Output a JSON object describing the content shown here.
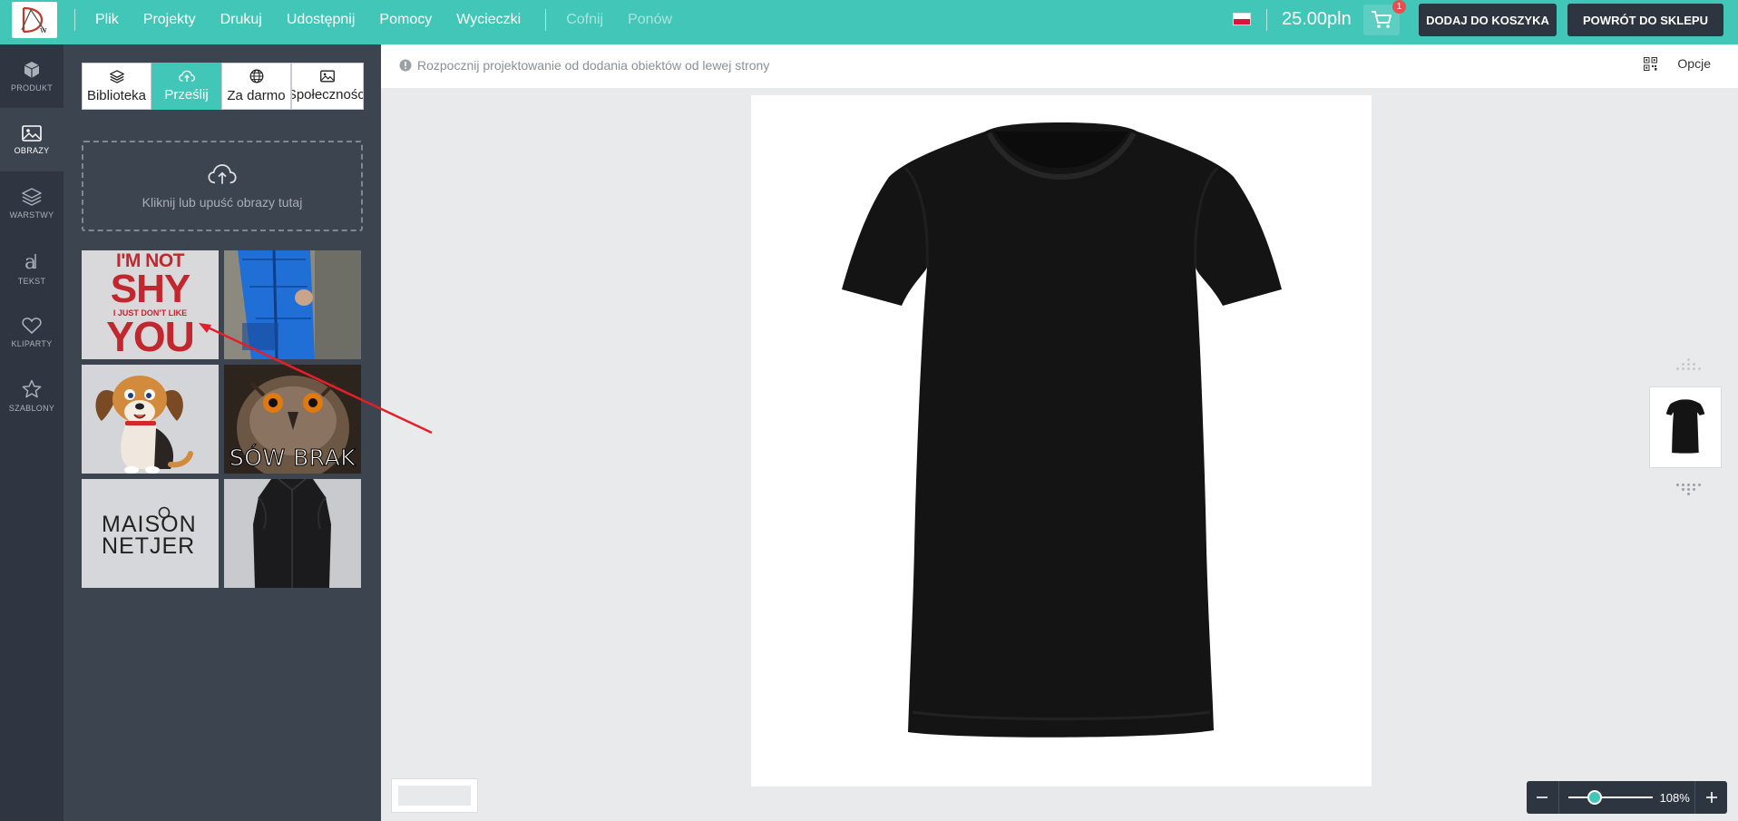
{
  "topbar": {
    "logo_letters": "DW",
    "menu": [
      "Plik",
      "Projekty",
      "Drukuj",
      "Udostępnij",
      "Pomocy",
      "Wycieczki"
    ],
    "undo_label": "Cofnij",
    "redo_label": "Ponów",
    "price": "25.00pln",
    "cart_count": "1",
    "add_to_cart_label": "DODAJ DO KOSZYKA",
    "back_to_shop_label": "POWRÓT DO SKLEPU",
    "accent_color": "#42c6b8",
    "language_flag": "pl-flag-icon"
  },
  "rail": {
    "items": [
      {
        "label": "PRODUKT",
        "icon": "box-icon"
      },
      {
        "label": "OBRAZY",
        "icon": "image-icon",
        "active": true
      },
      {
        "label": "WARSTWY",
        "icon": "layers-icon"
      },
      {
        "label": "TEKST",
        "icon": "text-icon"
      },
      {
        "label": "KLIPARTY",
        "icon": "heart-icon"
      },
      {
        "label": "SZABLONY",
        "icon": "star-icon"
      }
    ]
  },
  "panel": {
    "tabs": [
      {
        "label": "Biblioteka",
        "icon": "layers-icon"
      },
      {
        "label": "Prześlij",
        "icon": "cloud-upload-icon",
        "active": true
      },
      {
        "label": "Za darmo",
        "icon": "globe-icon"
      },
      {
        "label": "Społeczności",
        "icon": "image-icon"
      }
    ],
    "dropzone_label": "Kliknij lub upuść obrazy tutaj",
    "thumbnails": [
      {
        "name": "im-not-shy",
        "lines": [
          "I'M NOT",
          "SHY",
          "I JUST DON'T LIKE",
          "YOU"
        ]
      },
      {
        "name": "blue-jacket-photo"
      },
      {
        "name": "cartoon-dog"
      },
      {
        "name": "owl-sow-brak",
        "caption": "SÓW BRAK"
      },
      {
        "name": "maison-netjer-logo",
        "lines": [
          "MAISON",
          "NETJER"
        ]
      },
      {
        "name": "black-vest-photo"
      }
    ]
  },
  "canvas": {
    "hint": "Rozpocznij projektowanie od dodania obiektów od lewej strony",
    "options_label": "Opcje",
    "zoom": "108%",
    "zoom_fraction": 0.3
  }
}
